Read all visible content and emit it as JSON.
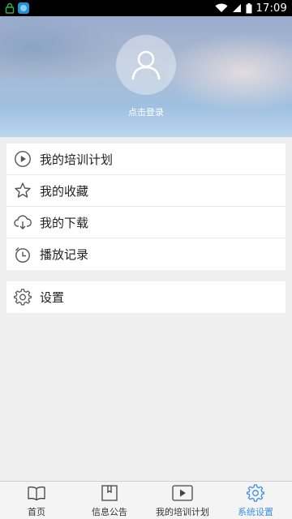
{
  "status_bar": {
    "time": "17:09"
  },
  "header": {
    "login_text": "点击登录"
  },
  "menu": {
    "group1": [
      {
        "label": "我的培训计划",
        "icon": "play-circle-icon"
      },
      {
        "label": "我的收藏",
        "icon": "star-icon"
      },
      {
        "label": "我的下载",
        "icon": "cloud-download-icon"
      },
      {
        "label": "播放记录",
        "icon": "alarm-clock-icon"
      }
    ],
    "group2": [
      {
        "label": "设置",
        "icon": "gear-icon"
      }
    ]
  },
  "tabbar": {
    "tabs": [
      {
        "label": "首页",
        "icon": "book-icon"
      },
      {
        "label": "信息公告",
        "icon": "notice-icon"
      },
      {
        "label": "我的培训计划",
        "icon": "video-play-icon"
      },
      {
        "label": "系统设置",
        "icon": "gear-icon",
        "active": true
      }
    ]
  },
  "colors": {
    "accent": "#3d8fe0",
    "icon_gray": "#555555"
  }
}
